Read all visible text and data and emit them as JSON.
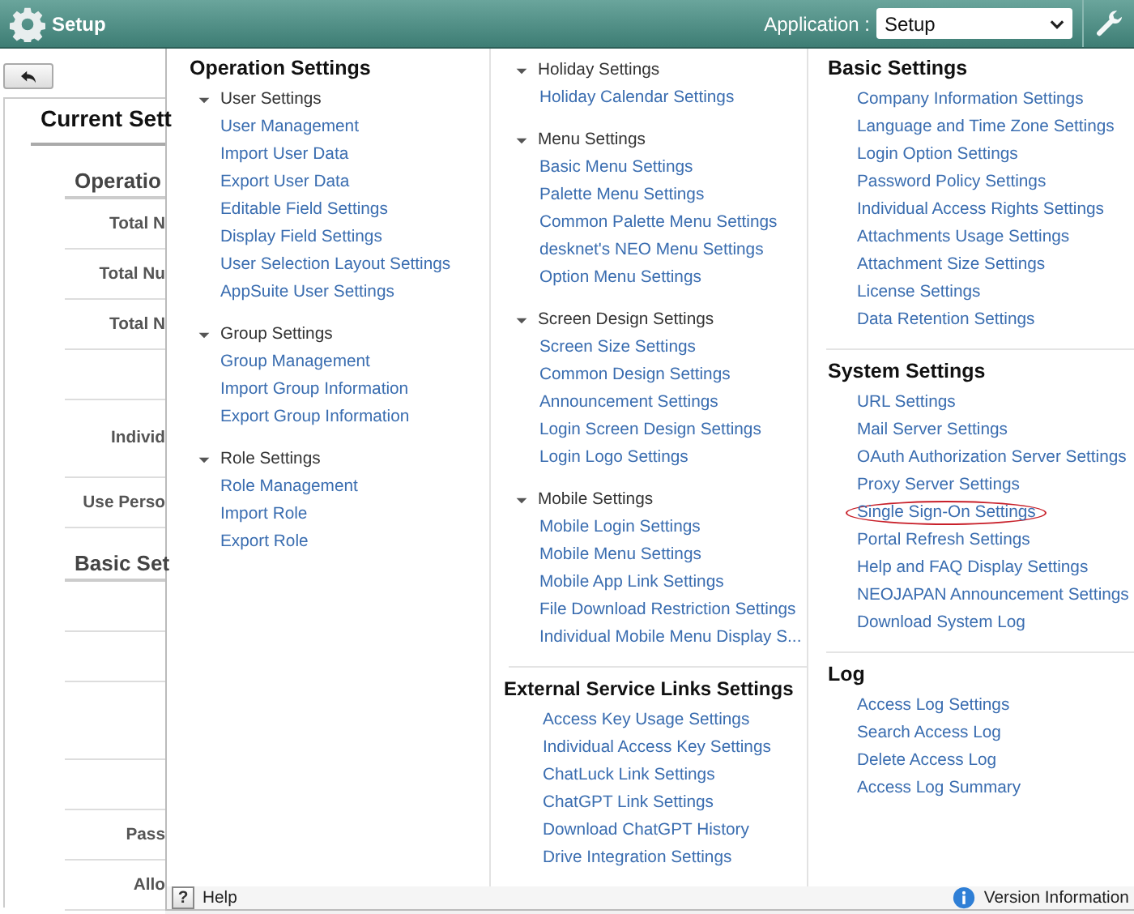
{
  "header": {
    "title": "Setup",
    "app_label": "Application :",
    "app_value": "Setup"
  },
  "page": {
    "title": "Current Sett",
    "rows": [
      {
        "kind": "section",
        "text": "Operatio"
      },
      {
        "kind": "field",
        "text": "Total N"
      },
      {
        "kind": "field",
        "text": "Total Nu"
      },
      {
        "kind": "field",
        "text": "Total N"
      },
      {
        "kind": "gap"
      },
      {
        "kind": "tall",
        "text": "Individ"
      },
      {
        "kind": "field",
        "text": "Use Perso"
      },
      {
        "kind": "section",
        "text": "Basic Set"
      },
      {
        "kind": "gap"
      },
      {
        "kind": "gap"
      },
      {
        "kind": "tallgap"
      },
      {
        "kind": "gap"
      },
      {
        "kind": "field",
        "text": "Pass"
      },
      {
        "kind": "field",
        "text": "Allo"
      }
    ]
  },
  "menu": {
    "columns": [
      {
        "blocks": [
          {
            "kind": "section",
            "title": "Operation Settings"
          },
          {
            "kind": "group",
            "title": "User Settings",
            "expanded": true,
            "links": [
              {
                "text": "User Management",
                "circled": false
              },
              {
                "text": "Import User Data",
                "circled": false
              },
              {
                "text": "Export User Data",
                "circled": false
              },
              {
                "text": "Editable Field Settings",
                "circled": false
              },
              {
                "text": "Display Field Settings",
                "circled": false
              },
              {
                "text": "User Selection Layout Settings",
                "circled": false
              },
              {
                "text": "AppSuite User Settings",
                "circled": false
              }
            ]
          },
          {
            "kind": "group",
            "title": "Group Settings",
            "expanded": true,
            "links": [
              {
                "text": "Group Management",
                "circled": false
              },
              {
                "text": "Import Group Information",
                "circled": false
              },
              {
                "text": "Export Group Information",
                "circled": false
              }
            ]
          },
          {
            "kind": "group",
            "title": "Role Settings",
            "expanded": true,
            "links": [
              {
                "text": "Role Management",
                "circled": false
              },
              {
                "text": "Import Role",
                "circled": false
              },
              {
                "text": "Export Role",
                "circled": false
              }
            ]
          }
        ]
      },
      {
        "blocks": [
          {
            "kind": "group",
            "title": "Holiday Settings",
            "expanded": true,
            "links": [
              {
                "text": "Holiday Calendar Settings",
                "circled": false
              }
            ]
          },
          {
            "kind": "group",
            "title": "Menu Settings",
            "expanded": true,
            "links": [
              {
                "text": "Basic Menu Settings",
                "circled": false
              },
              {
                "text": "Palette Menu Settings",
                "circled": false
              },
              {
                "text": "Common Palette Menu Settings",
                "circled": false
              },
              {
                "text": "desknet's NEO Menu Settings",
                "circled": false
              },
              {
                "text": "Option Menu Settings",
                "circled": false
              }
            ]
          },
          {
            "kind": "group",
            "title": "Screen Design Settings",
            "expanded": true,
            "links": [
              {
                "text": "Screen Size Settings",
                "circled": false
              },
              {
                "text": "Common Design Settings",
                "circled": false
              },
              {
                "text": "Announcement Settings",
                "circled": false
              },
              {
                "text": "Login Screen Design Settings",
                "circled": false
              },
              {
                "text": "Login Logo Settings",
                "circled": false
              }
            ]
          },
          {
            "kind": "group",
            "title": "Mobile Settings",
            "expanded": true,
            "links": [
              {
                "text": "Mobile Login Settings",
                "circled": false
              },
              {
                "text": "Mobile Menu Settings",
                "circled": false
              },
              {
                "text": "Mobile App Link Settings",
                "circled": false
              },
              {
                "text": "File Download Restriction Settings",
                "circled": false
              },
              {
                "text": "Individual Mobile Menu Display S...",
                "circled": false
              }
            ]
          },
          {
            "kind": "section",
            "title": "External Service Links Settings",
            "links": [
              {
                "text": "Access Key Usage Settings",
                "circled": false
              },
              {
                "text": "Individual Access Key Settings",
                "circled": false
              },
              {
                "text": "ChatLuck Link Settings",
                "circled": false
              },
              {
                "text": "ChatGPT Link Settings",
                "circled": false
              },
              {
                "text": "Download ChatGPT History",
                "circled": false
              },
              {
                "text": "Drive Integration Settings",
                "circled": false
              }
            ]
          }
        ]
      },
      {
        "blocks": [
          {
            "kind": "section",
            "title": "Basic Settings",
            "links": [
              {
                "text": "Company Information Settings",
                "circled": false
              },
              {
                "text": "Language and Time Zone Settings",
                "circled": false
              },
              {
                "text": "Login Option Settings",
                "circled": false
              },
              {
                "text": "Password Policy Settings",
                "circled": false
              },
              {
                "text": "Individual Access Rights Settings",
                "circled": false
              },
              {
                "text": "Attachments Usage Settings",
                "circled": false
              },
              {
                "text": "Attachment Size Settings",
                "circled": false
              },
              {
                "text": "License Settings",
                "circled": false
              },
              {
                "text": "Data Retention Settings",
                "circled": false
              }
            ]
          },
          {
            "kind": "section",
            "title": "System Settings",
            "links": [
              {
                "text": "URL Settings",
                "circled": false
              },
              {
                "text": "Mail Server Settings",
                "circled": false
              },
              {
                "text": "OAuth Authorization Server Settings",
                "circled": false
              },
              {
                "text": "Proxy Server Settings",
                "circled": false
              },
              {
                "text": "Single Sign-On Settings",
                "circled": true
              },
              {
                "text": "Portal Refresh Settings",
                "circled": false
              },
              {
                "text": "Help and FAQ Display Settings",
                "circled": false
              },
              {
                "text": "NEOJAPAN Announcement Settings",
                "circled": false
              },
              {
                "text": "Download System Log",
                "circled": false
              }
            ]
          },
          {
            "kind": "section",
            "title": "Log",
            "links": [
              {
                "text": "Access Log Settings",
                "circled": false
              },
              {
                "text": "Search Access Log",
                "circled": false
              },
              {
                "text": "Delete Access Log",
                "circled": false
              },
              {
                "text": "Access Log Summary",
                "circled": false
              }
            ]
          }
        ]
      }
    ]
  },
  "footer": {
    "help": "Help",
    "help_icon": "?",
    "version": "Version Information"
  }
}
